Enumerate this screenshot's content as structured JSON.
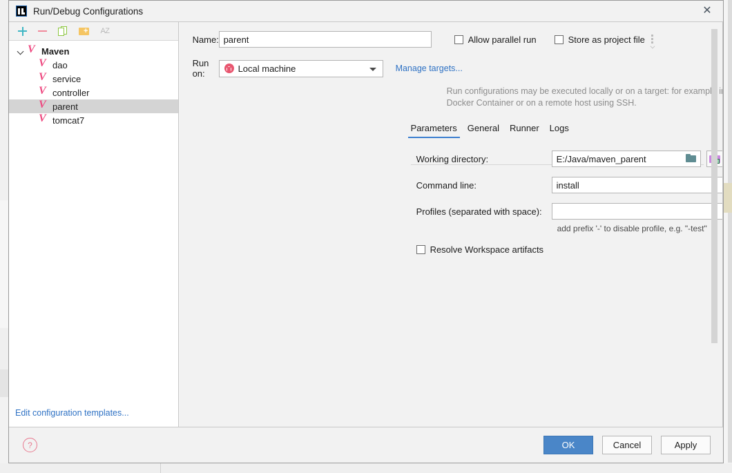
{
  "window": {
    "title": "Run/Debug Configurations",
    "logo_icon": "intellij-idea-logo",
    "close_icon": "close-icon"
  },
  "sidebar": {
    "toolbar": [
      {
        "name": "add",
        "icon": "plus-icon",
        "label": "+"
      },
      {
        "name": "remove",
        "icon": "minus-icon",
        "label": "−"
      },
      {
        "name": "copy",
        "icon": "copy-icon",
        "label": "Copy"
      },
      {
        "name": "new-folder",
        "icon": "folder-add-icon",
        "label": "New Folder"
      },
      {
        "name": "sort",
        "icon": "sort-alphabetically-icon",
        "label": "AZ"
      }
    ],
    "tree": {
      "root": {
        "label": "Maven",
        "icon": "maven-icon",
        "expanded": true
      },
      "items": [
        {
          "label": "dao",
          "icon": "maven-icon",
          "selected": false
        },
        {
          "label": "service",
          "icon": "maven-icon",
          "selected": false
        },
        {
          "label": "controller",
          "icon": "maven-icon",
          "selected": false
        },
        {
          "label": "parent",
          "icon": "maven-icon",
          "selected": true
        },
        {
          "label": "tomcat7",
          "icon": "maven-icon",
          "selected": false
        }
      ]
    },
    "footer_link": "Edit configuration templates..."
  },
  "main": {
    "name_label": "Name:",
    "name_value": "parent",
    "name_placeholder": "",
    "allow_parallel_run": {
      "label": "Allow parallel run",
      "checked": false
    },
    "store_as_project_file": {
      "label": "Store as project file",
      "checked": false,
      "more_icon": "kebab-dropdown-icon"
    },
    "run_on_label": "Run on:",
    "run_on_value": "Local machine",
    "run_on_icon": "local-machine-home-icon",
    "manage_targets_link": "Manage targets...",
    "description": "Run configurations may be executed locally or on a target: for example in a Docker Container or on a remote host using SSH.",
    "tabs": [
      {
        "label": "Parameters",
        "active": true
      },
      {
        "label": "General",
        "active": false
      },
      {
        "label": "Runner",
        "active": false
      },
      {
        "label": "Logs",
        "active": false
      }
    ],
    "fields": {
      "working_directory": {
        "label": "Working directory:",
        "value": "E:/Java/maven_parent",
        "placeholder": "",
        "browse_icon": "folder-browse-icon",
        "module_button_icon": "module-folder-icon"
      },
      "command_line": {
        "label": "Command line:",
        "value": "install",
        "placeholder": ""
      },
      "profiles": {
        "label": "Profiles (separated with space):",
        "value": "",
        "placeholder": "",
        "hint": "add prefix '-' to disable profile, e.g. \"-test\""
      }
    },
    "resolve_workspace_artifacts": {
      "label": "Resolve Workspace artifacts",
      "checked": false
    }
  },
  "footer": {
    "help_icon": "help-question-icon",
    "ok": "OK",
    "cancel": "Cancel",
    "apply": "Apply"
  },
  "colors": {
    "accent_blue": "#4a86c8",
    "link_blue": "#2f72c4",
    "maven_pink": "#ee4a81",
    "tab_underline": "#3c7fd0",
    "selection_gray": "#d4d4d4"
  }
}
